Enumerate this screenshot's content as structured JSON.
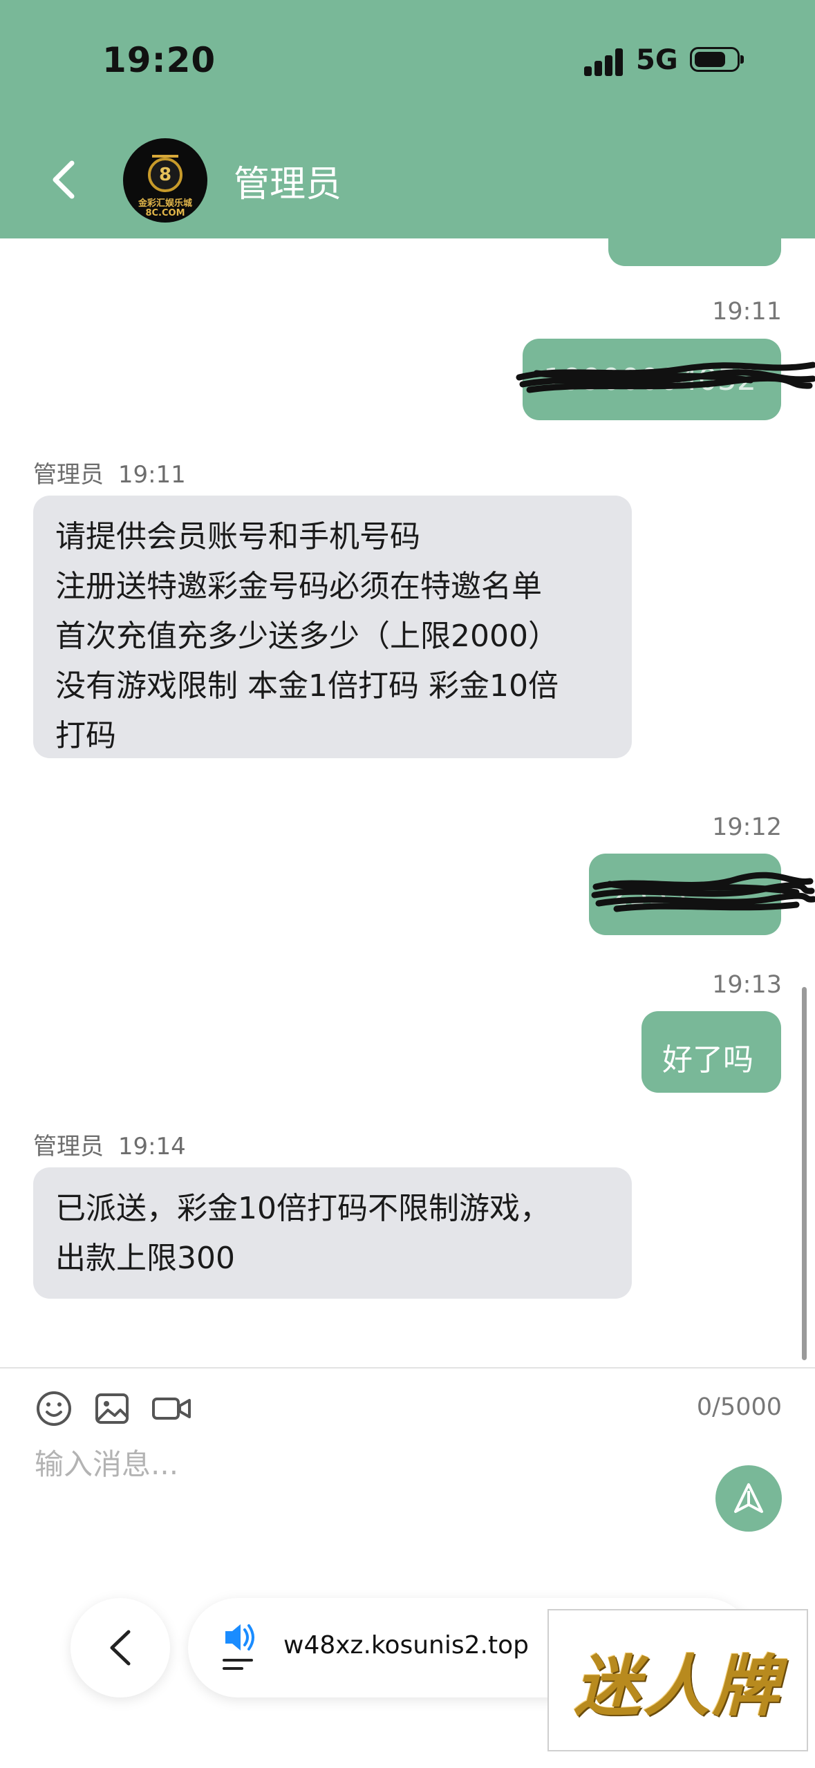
{
  "status_bar": {
    "time": "19:20",
    "network": "5G",
    "battery_level": 0.75
  },
  "header": {
    "title": "管理员",
    "avatar_text": "金彩汇娱乐城",
    "avatar_subtext": "8C.COM",
    "avatar_ball": "8"
  },
  "messages": [
    {
      "direction": "outgoing",
      "time": "19:11",
      "text": "19900004052",
      "redacted": true
    },
    {
      "direction": "incoming",
      "sender": "管理员",
      "time": "19:11",
      "lines": [
        "请提供会员账号和手机号码",
        "注册送特邀彩金号码必须在特邀名单",
        "首次充值充多少送多少（上限2000）",
        "没有游戏限制 本金1倍打码 彩金10倍",
        "打码"
      ]
    },
    {
      "direction": "outgoing",
      "time": "19:12",
      "text": "2533",
      "redacted": true
    },
    {
      "direction": "outgoing",
      "time": "19:13",
      "text": "好了吗",
      "redacted": false
    },
    {
      "direction": "incoming",
      "sender": "管理员",
      "time": "19:14",
      "lines": [
        "已派送，彩金10倍打码不限制游戏，",
        "出款上限300"
      ]
    }
  ],
  "composer": {
    "tools": [
      "smile-icon",
      "image-icon",
      "video-icon"
    ],
    "counter": "0/5000",
    "placeholder": "输入消息...",
    "send_icon": "send-icon"
  },
  "browser": {
    "url": "w48xz.kosunis2.top",
    "sound_icon": "speaker-icon"
  },
  "overlay_ad": {
    "text": "迷人牌"
  },
  "colors": {
    "accent": "#79b898",
    "incoming_bubble": "#e4e5e9",
    "outgoing_text": "#ffffff"
  }
}
